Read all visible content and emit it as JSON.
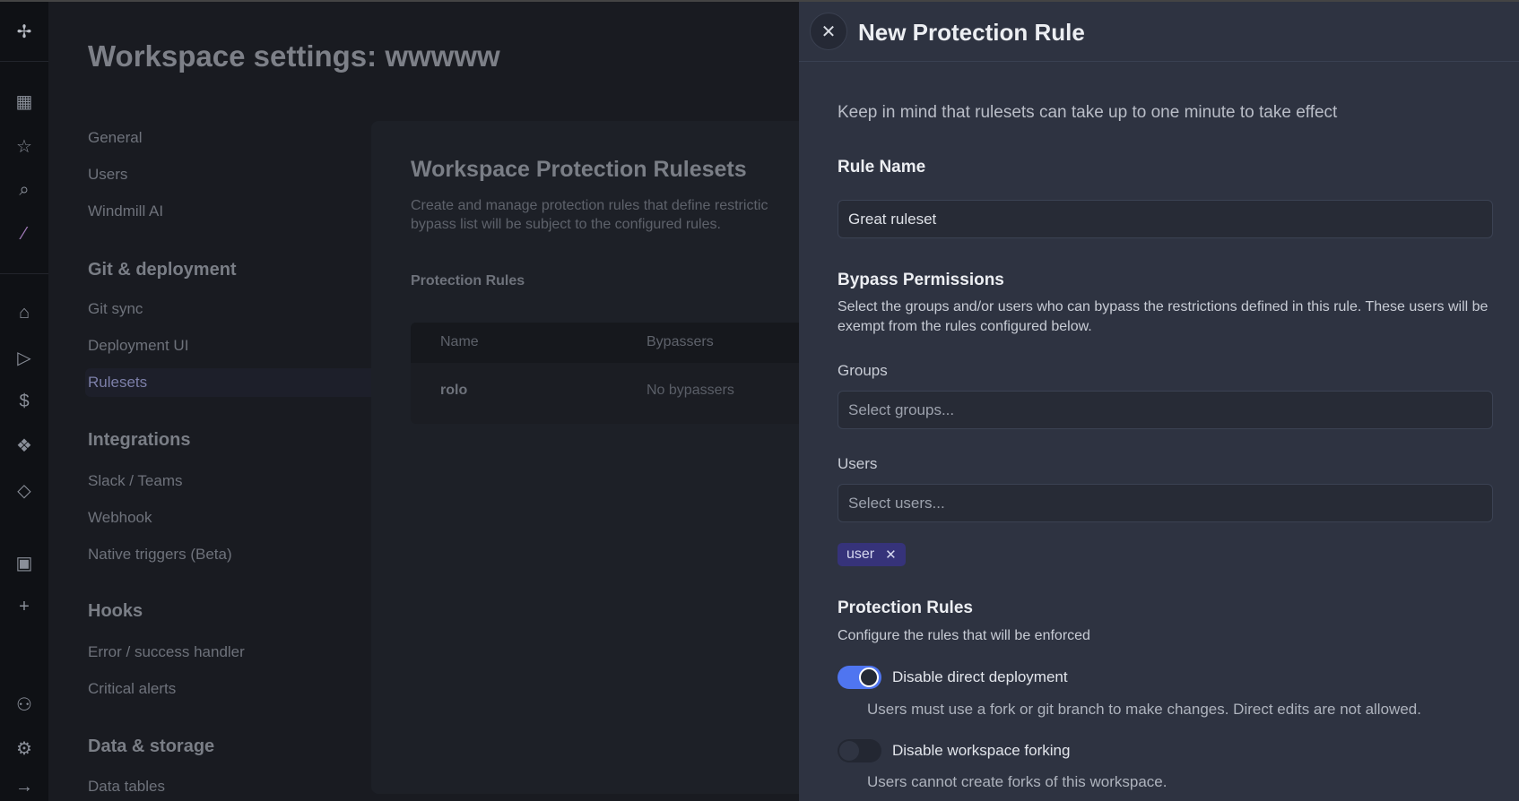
{
  "rail": {
    "icons": [
      "windmill-logo-icon",
      "building-icon",
      "star-icon",
      "search-icon",
      "magic-wand-icon",
      "home-icon",
      "play-icon",
      "dollar-icon",
      "boxes-icon",
      "diamond-icon",
      "calendar-icon",
      "plus-icon",
      "user-icon",
      "gear-icon",
      "arrow-right-icon"
    ]
  },
  "page": {
    "title": "Workspace settings: wwwww"
  },
  "nav": {
    "items": [
      "General",
      "Users",
      "Windmill AI"
    ],
    "sections": [
      {
        "title": "Git & deployment",
        "items": [
          "Git sync",
          "Deployment UI",
          "Rulesets"
        ]
      },
      {
        "title": "Integrations",
        "items": [
          "Slack / Teams",
          "Webhook",
          "Native triggers (Beta)"
        ]
      },
      {
        "title": "Hooks",
        "items": [
          "Error / success handler",
          "Critical alerts"
        ]
      },
      {
        "title": "Data & storage",
        "items": [
          "Data tables"
        ]
      }
    ],
    "selected": "Rulesets"
  },
  "card": {
    "title": "Workspace Protection Rulesets",
    "description": "Create and manage protection rules that define restrictions ... bypass list will be subject to the configured rules.",
    "desc_line1": "Create and manage protection rules that define restrictic",
    "desc_line2": "bypass list will be subject to the configured rules.",
    "subtitle": "Protection Rules",
    "table": {
      "headers": [
        "Name",
        "Bypassers"
      ],
      "rows": [
        [
          "rolo",
          "No bypassers"
        ]
      ]
    }
  },
  "drawer": {
    "title": "New Protection Rule",
    "info": "Keep in mind that rulesets can take up to one minute to take effect",
    "rule_name_label": "Rule Name",
    "rule_name_value": "Great ruleset",
    "bypass_title": "Bypass Permissions",
    "bypass_desc": "Select the groups and/or users who can bypass the restrictions defined in this rule. These users will be exempt from the rules configured below.",
    "groups_label": "Groups",
    "groups_placeholder": "Select groups...",
    "users_label": "Users",
    "users_placeholder": "Select users...",
    "selected_users": [
      "user"
    ],
    "rules_title": "Protection Rules",
    "rules_desc": "Configure the rules that will be enforced",
    "rules": [
      {
        "label": "Disable direct deployment",
        "description": "Users must use a fork or git branch to make changes. Direct edits are not allowed.",
        "enabled": true
      },
      {
        "label": "Disable workspace forking",
        "description": "Users cannot create forks of this workspace.",
        "enabled": false
      }
    ]
  },
  "colors": {
    "accent": "#4f75f0",
    "chip": "#36337a",
    "drawer_bg": "#2e3341"
  }
}
